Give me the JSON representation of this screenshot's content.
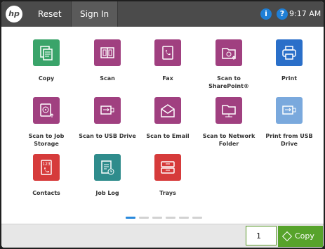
{
  "topbar": {
    "logo": "hp",
    "reset": "Reset",
    "sign_in": "Sign In",
    "time": "9:17 AM",
    "info_icon": "i",
    "help_icon": "?"
  },
  "colors": {
    "topbar": "#4b4b4b",
    "green": "#3aa46a",
    "purple": "#a04080",
    "red": "#d63b3b",
    "blue": "#2a6fc9",
    "lightblue": "#7aa9dd",
    "teal": "#2f8c8c",
    "accent": "#57a32b"
  },
  "apps": [
    {
      "label": "Copy",
      "icon": "copy-icon"
    },
    {
      "label": "Scan",
      "icon": "scan-icon"
    },
    {
      "label": "Fax",
      "icon": "fax-icon"
    },
    {
      "label": "Scan to SharePoint®",
      "icon": "sharepoint-icon"
    },
    {
      "label": "Print",
      "icon": "printer-icon"
    },
    {
      "label": "Scan to Job Storage",
      "icon": "job-storage-icon"
    },
    {
      "label": "Scan to USB Drive",
      "icon": "usb-scan-icon"
    },
    {
      "label": "Scan to Email",
      "icon": "email-icon"
    },
    {
      "label": "Scan to Network Folder",
      "icon": "network-folder-icon"
    },
    {
      "label": "Print from USB Drive",
      "icon": "usb-print-icon"
    },
    {
      "label": "Contacts",
      "icon": "contacts-icon"
    },
    {
      "label": "Job Log",
      "icon": "job-log-icon"
    },
    {
      "label": "Trays",
      "icon": "trays-icon"
    }
  ],
  "pager": {
    "pages": 6,
    "current": 1
  },
  "bottom": {
    "copies": "1",
    "copy_label": "Copy"
  }
}
